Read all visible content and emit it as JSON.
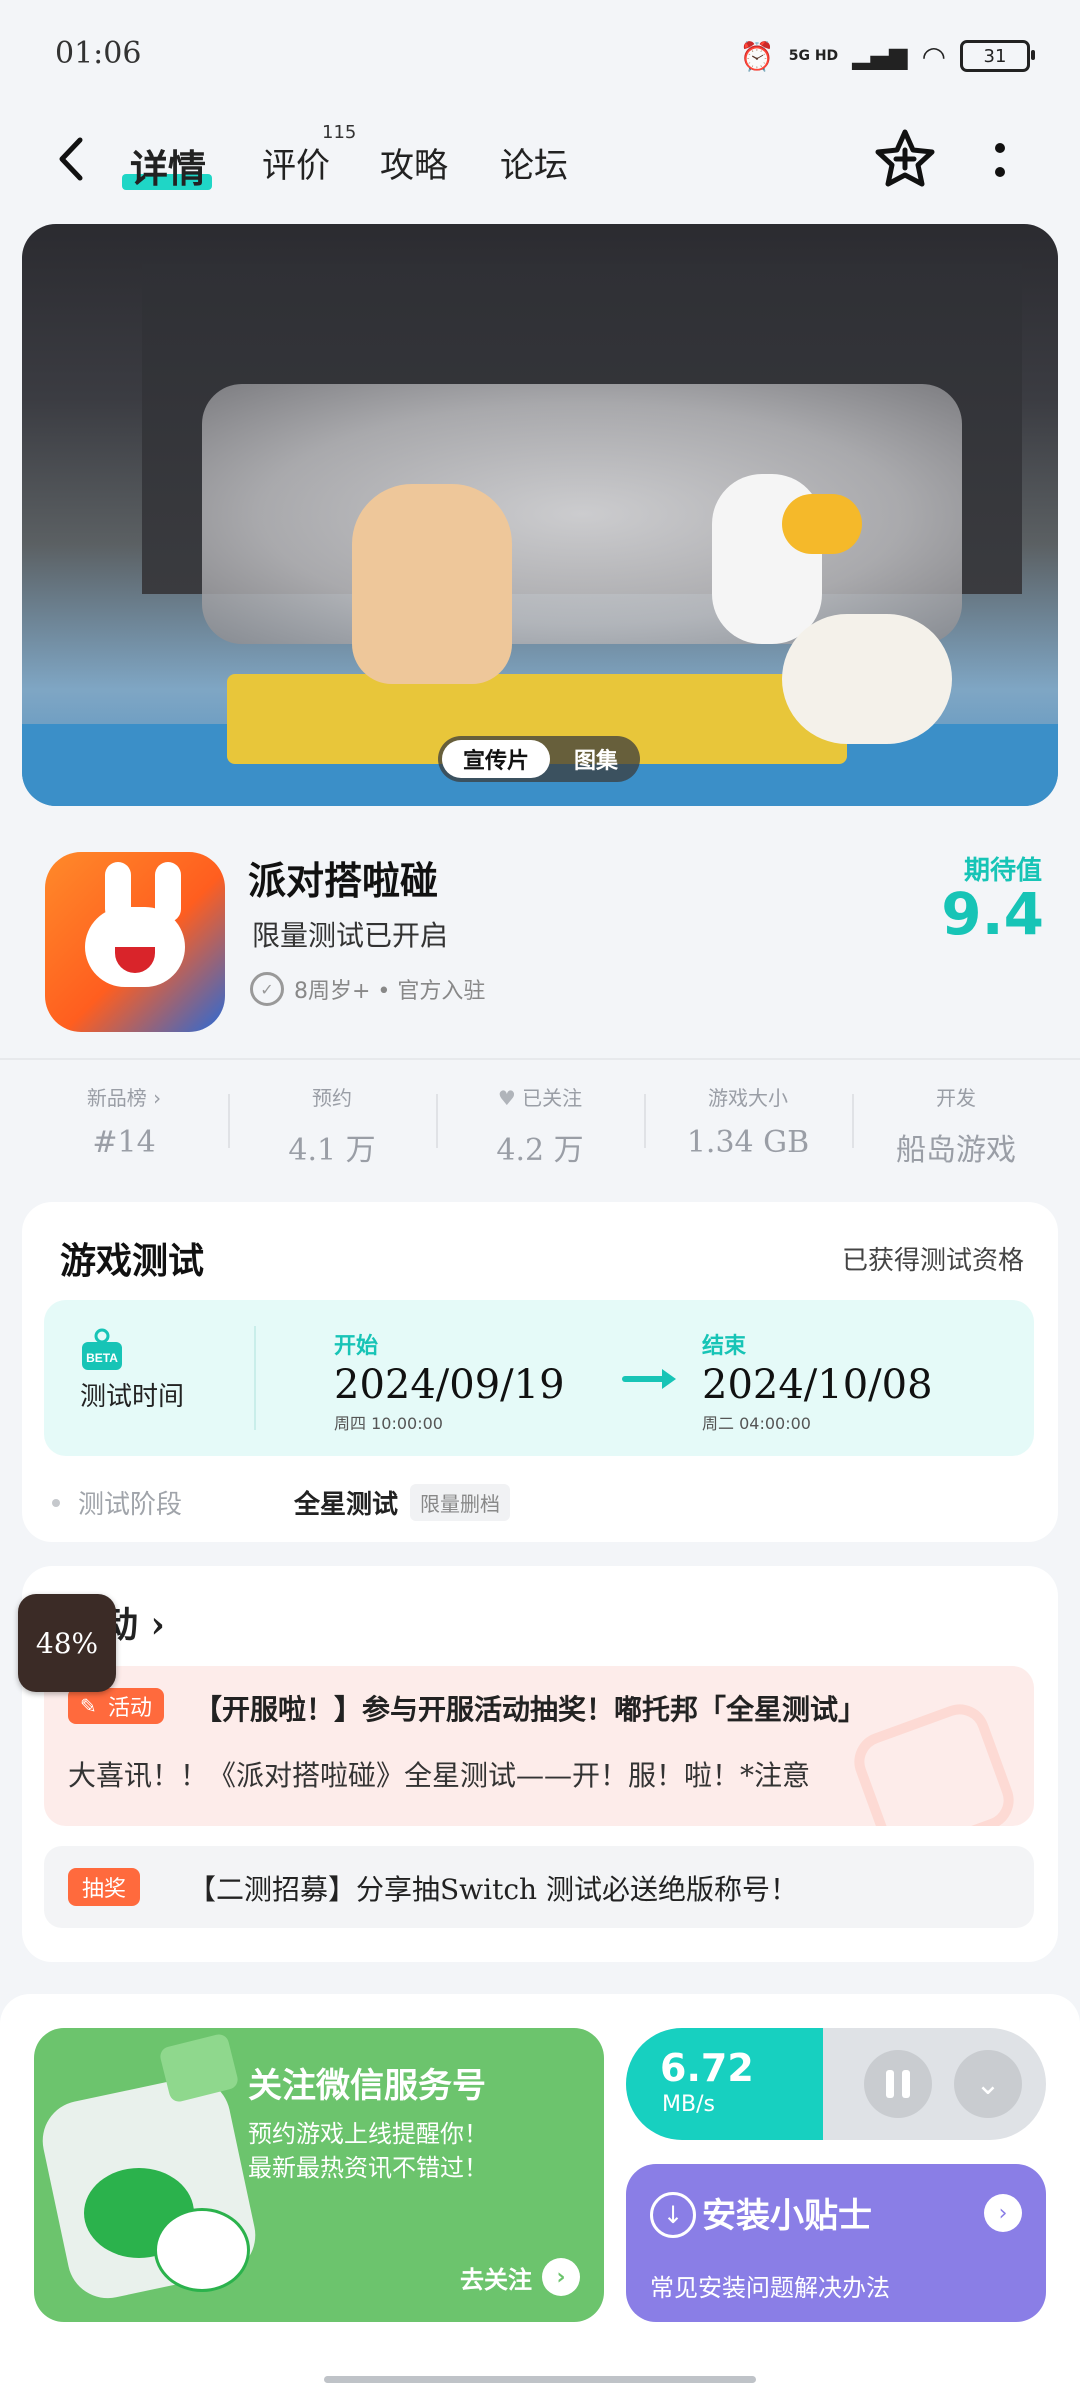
{
  "status_bar": {
    "time": "01:06",
    "network": "5G HD",
    "battery": "31"
  },
  "nav": {
    "tabs": [
      {
        "label": "详情",
        "active": true
      },
      {
        "label": "评价",
        "count": "115"
      },
      {
        "label": "攻略"
      },
      {
        "label": "论坛"
      }
    ],
    "icons": [
      "back-icon",
      "add-to-collection-icon",
      "more-icon"
    ]
  },
  "hero": {
    "switch": {
      "promo": "宣传片",
      "gallery": "图集"
    }
  },
  "game": {
    "title": "派对搭啦碰",
    "subtitle": "限量测试已开启",
    "meta": "8周岁+ • 官方入驻",
    "expect_label": "期待值",
    "expect_value": "9.4"
  },
  "stats": [
    {
      "label": "新品榜 ›",
      "value": "#14"
    },
    {
      "label": "预约",
      "value": "4.1 万"
    },
    {
      "label": "已关注",
      "value": "4.2 万"
    },
    {
      "label": "游戏大小",
      "value": "1.34 GB"
    },
    {
      "label": "开发",
      "value": "船岛游戏"
    }
  ],
  "test": {
    "title": "游戏测试",
    "qualification": "已获得测试资格",
    "beta_badge": "BETA",
    "time_label": "测试时间",
    "start": {
      "tag": "开始",
      "date": "2024/09/19",
      "week": "周四 10:00:00"
    },
    "end": {
      "tag": "结束",
      "date": "2024/10/08",
      "week": "周二 04:00:00"
    },
    "phase_label": "测试阶段",
    "phase_value": "全星测试",
    "phase_tag": "限量删档"
  },
  "activity": {
    "header": "动 ›",
    "items": [
      {
        "tag": "活动",
        "title": "【开服啦！】参与开服活动抽奖！嘟托邦「全星测试」",
        "desc": "大喜讯！！《派对搭啦碰》全星测试——开！服！啦！*注意"
      },
      {
        "tag": "抽奖",
        "title": "【二测招募】分享抽Switch 测试必送绝版称号！"
      }
    ]
  },
  "floating_progress": "48%",
  "bottom": {
    "wechat": {
      "title": "关注微信服务号",
      "line1": "预约游戏上线提醒你！",
      "line2": "最新最热资讯不错过！",
      "action": "去关注"
    },
    "download": {
      "speed": "6.72",
      "unit": "MB/s",
      "progress": 0.47
    },
    "tips": {
      "title": "安装小贴士",
      "subtitle": "常见安装问题解决办法"
    }
  },
  "colors": {
    "accent": "#17c4b6",
    "orange_tag": "#ff6a3d",
    "wechat_green": "#6cc46d",
    "tips_purple": "#8a7ee6"
  }
}
